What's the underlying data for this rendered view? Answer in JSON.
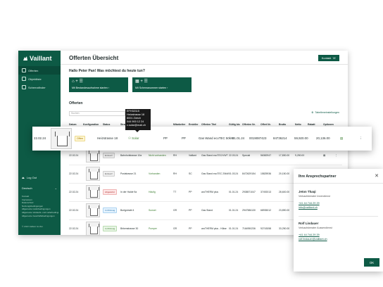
{
  "sidebar": {
    "logo": "Vaillant",
    "items": [
      {
        "label": "Offerten",
        "icon": "document-icon"
      },
      {
        "label": "Objektliste",
        "icon": "house-icon"
      },
      {
        "label": "Schemafinder",
        "icon": "grid-icon"
      }
    ],
    "logout": "Log Out",
    "language": "Deutsch",
    "footer_links": [
      "Kontakt",
      "Impressum",
      "Datenschutz",
      "Nutzungsbedingungen",
      "Allgemeine Lieferbedingungen",
      "Allgemeine Verkaufs- und Lieferbedingungen",
      "Allgemeine Geschäftsbedingungen"
    ],
    "copyright": "© 2023 Vaillant GmbH"
  },
  "header": {
    "title": "Offerten Übersicht",
    "contact_button": "Kontakt"
  },
  "greeting": "Hallo Peter Pan! Was möchtest du heute tun?",
  "actions": [
    {
      "label": "Mit Bestandesaufnahme starten",
      "icon": "plus-icon"
    },
    {
      "label": "Mit Schemanummer starten",
      "icon": "plus-icon"
    }
  ],
  "offers": {
    "title": "Offerten",
    "search_placeholder": "Suchen",
    "settings_label": "Tabelleneinstellungen",
    "columns": [
      "Datum",
      "Konfiguration",
      "Status",
      "Strasse",
      "Solar",
      "PP",
      "Mitarbeiter",
      "Ersteller",
      "Offerten Titel",
      "Gültig bis",
      "Offerten Nr.",
      "Offert Nr.",
      "Brutto",
      "Netto",
      "Rabatt",
      "Optionen"
    ],
    "rows": [
      {
        "date": "22.02.24",
        "status": "Entwurf",
        "status_class": "b-entwurf",
        "street": "Bahnhofstrasse 10a",
        "solar": "Nicht vorhanden",
        "pp": "RH",
        "staff": "Vaillant",
        "title": "Gas Stand ecoTEC/VWT",
        "valid": "22.03.24",
        "offer": "Special",
        "nr": "56382947",
        "brutto": "17,830.00",
        "netto": "9,250.00"
      },
      {
        "date": "22.02.24",
        "status": "Entwurf",
        "status_class": "b-entwurf",
        "street": "Poststrasse 21",
        "solar": "Vorhanden",
        "pp": "RH",
        "staff": "SC",
        "title": "Gas Stand ecoTEC 20kW",
        "valid": "01.03.24",
        "offer": "8472629154",
        "nr": "15825936",
        "brutto": "20,150.00",
        "netto": "11,500.00"
      },
      {
        "date": "22.02.24",
        "status": "Abgelehnt",
        "status_class": "b-abgelehnt",
        "street": "In der Halde 9a",
        "solar": "Häufig",
        "pp": "TT",
        "staff": "PP",
        "title": "aroTHERM plus",
        "valid": "01.01.24",
        "offer": "2938571047",
        "nr": "37492013",
        "brutto": "28,600.00",
        "netto": "16,900.00"
      },
      {
        "date": "22.02.24",
        "status": "In Prüfung",
        "status_class": "b-pruefung",
        "street": "Burtgstrabt 4",
        "solar": "Sunset",
        "pp": "GR",
        "staff": "PP",
        "title": "Gas Stand",
        "valid": "01.01.24",
        "offer": "2947586130",
        "nr": "68935012",
        "brutto": "23,890.00",
        "netto": "13,200.00"
      },
      {
        "date": "22.02.24",
        "status": "In Prüfung",
        "status_class": "b-fertig",
        "street": "Birkenstrasse 30",
        "solar": "Pumper",
        "pp": "GR",
        "staff": "PP",
        "title": "aroTHERM plus - Hülse",
        "valid": "01.01.24",
        "offer": "7164950236",
        "nr": "92743058",
        "brutto": "33,250.00",
        "netto": "19,700.00"
      }
    ]
  },
  "highlighted_row": {
    "date": "22.02.24",
    "status": "Offen",
    "street": "Heizstrasse 18",
    "solar": "Solar",
    "pp": "PP",
    "staff": "PP",
    "title": "Gas Wand ecoTEC 50kW",
    "valid": "01.01.24",
    "offer": "0019087423",
    "nr": "84736214",
    "brutto": "59,920.00",
    "netto": "20,136.00"
  },
  "tooltip": {
    "lines": [
      "EFH32115",
      "Heizstrasse 18",
      "8001 Zürich",
      "044 900 12 24",
      "c.solar@mail.ch"
    ]
  },
  "contacts_panel": {
    "title": "Ihre Ansprechspartner",
    "contacts": [
      {
        "name": "Jeton Thaqi",
        "role": "Verkaufsberater Innendienst",
        "phone": "+41 44 744 29 29",
        "email": "info@vaillant.ch"
      },
      {
        "name": "Rolf Lindauer",
        "role": "Verkaufsberater Aussendienst",
        "phone": "+41 44 744 29 29",
        "email": "rolf.lindauer@vaillant.ch"
      }
    ],
    "ok_label": "OK"
  }
}
